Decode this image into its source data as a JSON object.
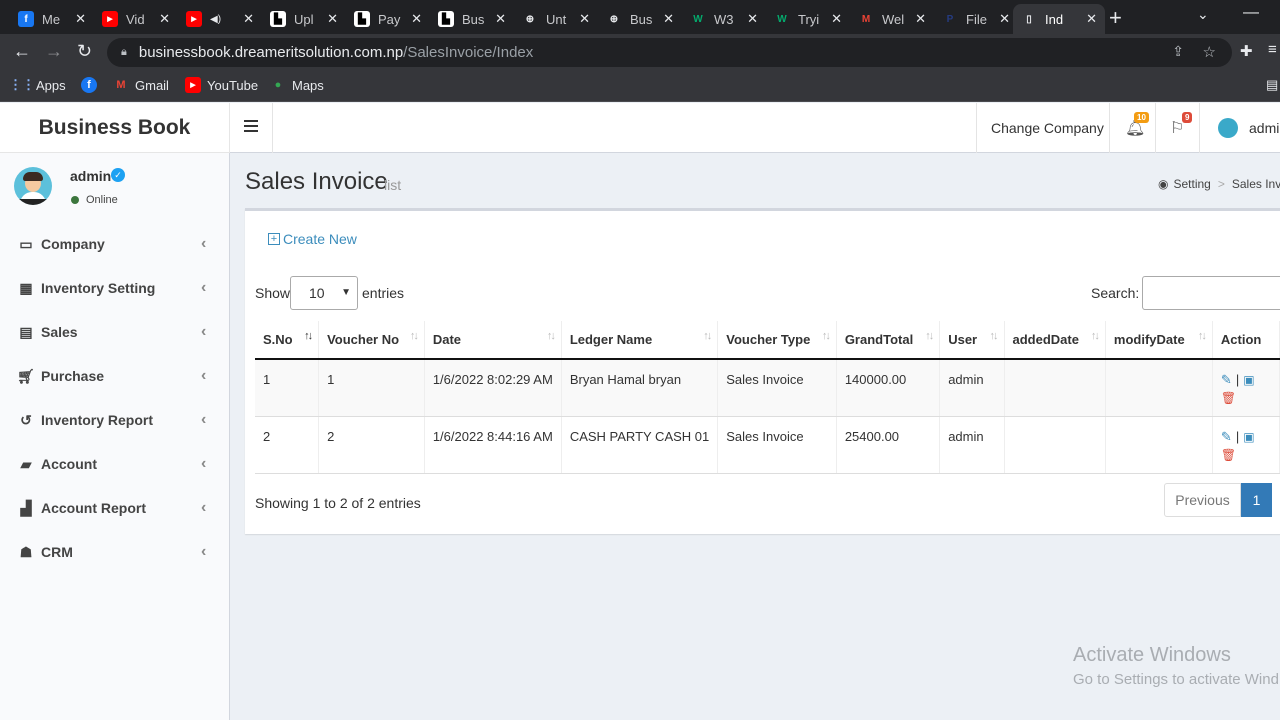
{
  "browser": {
    "tabs": [
      {
        "title": "Me",
        "favicon": "facebook-icon",
        "color": "#1877f2",
        "glyph": "f"
      },
      {
        "title": "Vid",
        "favicon": "youtube-icon",
        "color": "#ff0000",
        "glyph": "▶"
      },
      {
        "title": "",
        "favicon": "youtube-icon",
        "color": "#ff0000",
        "glyph": "▶"
      },
      {
        "title": "Upl",
        "favicon": "document-icon",
        "color": "#ffffff",
        "glyph": ""
      },
      {
        "title": "Pay",
        "favicon": "document-icon",
        "color": "#ffffff",
        "glyph": ""
      },
      {
        "title": "Bus",
        "favicon": "document-icon",
        "color": "#ffffff",
        "glyph": ""
      },
      {
        "title": "Unt",
        "favicon": "globe-icon",
        "color": "#e8eaed",
        "glyph": "⊕"
      },
      {
        "title": "Bus",
        "favicon": "globe-icon",
        "color": "#e8eaed",
        "glyph": "⊕"
      },
      {
        "title": "W3",
        "favicon": "w3schools-icon",
        "color": "#04aa6d",
        "glyph": "W"
      },
      {
        "title": "Tryi",
        "favicon": "w3schools-icon",
        "color": "#04aa6d",
        "glyph": "W"
      },
      {
        "title": "Wel",
        "favicon": "gmail-icon",
        "color": "#ea4335",
        "glyph": "M"
      },
      {
        "title": "File",
        "favicon": "paypal-icon",
        "color": "#253b80",
        "glyph": "P"
      },
      {
        "title": "Ind",
        "favicon": "page-icon",
        "color": "#8ab4f8",
        "glyph": ""
      }
    ],
    "url_host": "businessbook.dreameritsolution.com.np",
    "url_path": "/SalesInvoice/Index",
    "bookmarks": [
      {
        "label": "Apps"
      },
      {
        "label": ""
      },
      {
        "label": "Gmail"
      },
      {
        "label": "YouTube"
      },
      {
        "label": "Maps"
      }
    ]
  },
  "app": {
    "brand": "Business Book",
    "header": {
      "change_company": "Change Company",
      "notifications_count": "10",
      "flags_count": "9",
      "user": "admi"
    },
    "sidebar": {
      "user_name": "admin",
      "status": "Online",
      "items": [
        {
          "label": "Company",
          "icon": "bank-icon"
        },
        {
          "label": "Inventory Setting",
          "icon": "grid-icon"
        },
        {
          "label": "Sales",
          "icon": "file-icon"
        },
        {
          "label": "Purchase",
          "icon": "cart-icon"
        },
        {
          "label": "Inventory Report",
          "icon": "history-icon"
        },
        {
          "label": "Account",
          "icon": "book-icon"
        },
        {
          "label": "Account Report",
          "icon": "report-icon"
        },
        {
          "label": "CRM",
          "icon": "user-plus-icon"
        }
      ]
    }
  },
  "page": {
    "title": "Sales Invoice",
    "subtitle": "list",
    "breadcrumb": [
      "Setting",
      "Sales Inv"
    ],
    "create_new": "Create New",
    "show_label": "Show",
    "page_size": "10",
    "entries_label": "entries",
    "search_label": "Search:",
    "table": {
      "columns": [
        "S.No",
        "Voucher No",
        "Date",
        "Ledger Name",
        "Voucher Type",
        "GrandTotal",
        "User",
        "addedDate",
        "modifyDate",
        "Action"
      ],
      "rows": [
        [
          "1",
          "1",
          "1/6/2022 8:02:29 AM",
          "Bryan Hamal bryan",
          "Sales Invoice",
          "140000.00",
          "admin",
          "",
          ""
        ],
        [
          "2",
          "2",
          "1/6/2022 8:44:16 AM",
          "CASH PARTY CASH 01",
          "Sales Invoice",
          "25400.00",
          "admin",
          "",
          ""
        ]
      ]
    },
    "info": "Showing 1 to 2 of 2 entries",
    "pager": {
      "previous": "Previous",
      "current": "1"
    }
  },
  "watermark": {
    "line1": "Activate Windows",
    "line2": "Go to Settings to activate Wind"
  }
}
